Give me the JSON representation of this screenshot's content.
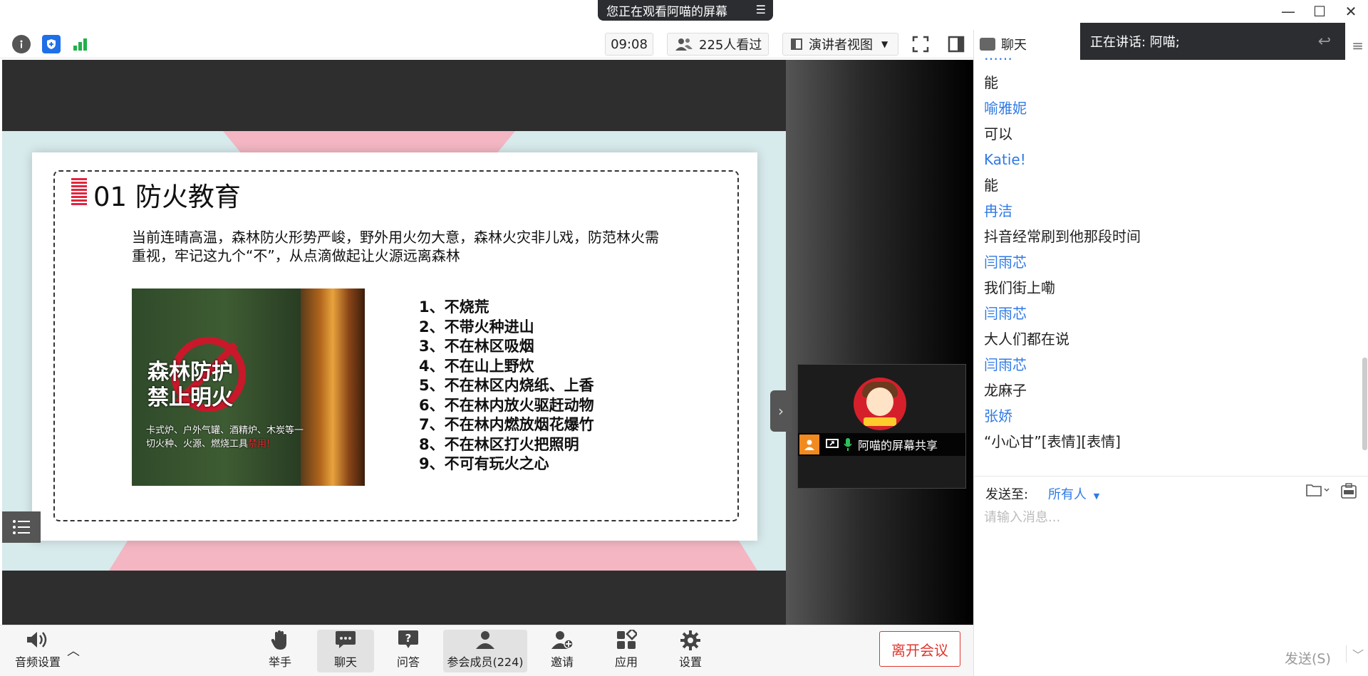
{
  "window": {
    "share_banner": "您正在观看阿喵的屏幕",
    "menu_glyph": "☰",
    "minimize": "—",
    "maximize": "☐",
    "close": "✕"
  },
  "toolbar": {
    "time": "09:08",
    "viewers": "225人看过",
    "view_mode": "演讲者视图",
    "colors": {
      "shield": "#1f6fe8",
      "signal": "#1fb14b"
    }
  },
  "slide": {
    "title": "01 防火教育",
    "intro": "当前连晴高温，森林防火形势严峻，野外用火勿大意，森林火灾非儿戏，防范林火需重视，牢记这九个“不”，从点滴做起让火源远离森林",
    "image_title_1": "森林防护",
    "image_title_2": "禁止明火",
    "image_sub": "卡式炉、户外气罐、酒精炉、木炭等一切火种、火源、燃烧工具",
    "image_sub_red": "禁用!",
    "rules": [
      "1、不烧荒",
      "2、不带火种进山",
      "3、不在林区吸烟",
      "4、不在山上野炊",
      "5、不在林区内烧纸、上香",
      "6、不在林内放火驱赶动物",
      "7、不在林内燃放烟花爆竹",
      "8、不在林区打火把照明",
      "9、不可有玩火之心"
    ]
  },
  "video": {
    "label": "阿喵的屏幕共享"
  },
  "bottombar": {
    "audio": "音频设置",
    "raise_hand": "举手",
    "chat": "聊天",
    "qa": "问答",
    "members": "参会成员(224)",
    "invite": "邀请",
    "apps": "应用",
    "settings": "设置",
    "leave": "离开会议"
  },
  "chat": {
    "title": "聊天",
    "speaking": "正在讲话: 阿喵;",
    "messages": [
      {
        "name": "",
        "text": "能"
      },
      {
        "name": "喻雅妮",
        "text": "可以"
      },
      {
        "name": "Katie!",
        "text": "能"
      },
      {
        "name": "冉洁",
        "text": "抖音经常刷到他那段时间"
      },
      {
        "name": "闫雨芯",
        "text": "我们街上嘞"
      },
      {
        "name": "闫雨芯",
        "text": "大人们都在说"
      },
      {
        "name": "闫雨芯",
        "text": "龙麻子"
      },
      {
        "name": "张娇",
        "text": "“小心甘”[表情][表情]"
      }
    ],
    "send_to_label": "发送至:",
    "send_to_value": "所有人",
    "input_placeholder": "请输入消息...",
    "send_button": "发送(S)"
  }
}
